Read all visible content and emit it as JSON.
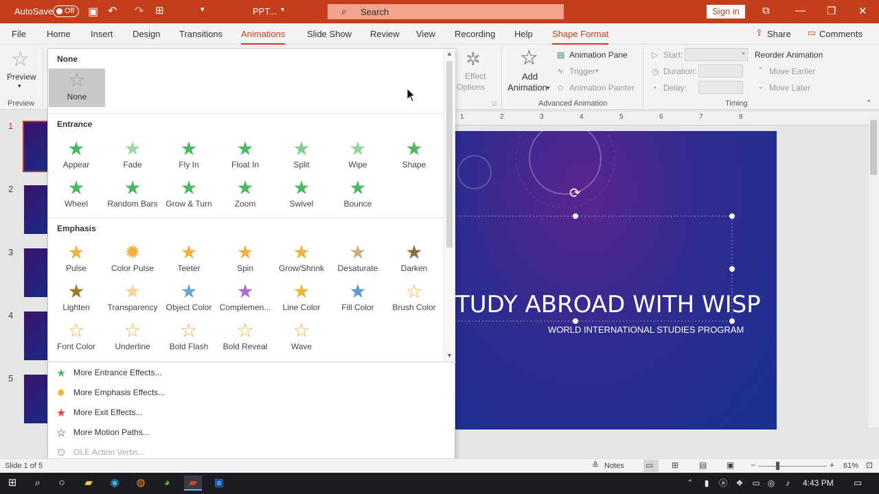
{
  "titlebar": {
    "autosave_label": "AutoSave",
    "autosave_state": "Off",
    "file_name": "PPT...",
    "search_placeholder": "Search",
    "signin_label": "Sign in"
  },
  "menu": {
    "tabs": [
      "File",
      "Home",
      "Insert",
      "Design",
      "Transitions",
      "Animations",
      "Slide Show",
      "Review",
      "View",
      "Recording",
      "Help",
      "Shape Format"
    ],
    "share_label": "Share",
    "comments_label": "Comments"
  },
  "ribbon": {
    "preview_label": "Preview",
    "preview_group": "Preview",
    "effect_options_1": "Effect",
    "effect_options_2": "Options",
    "add_animation_1": "Add",
    "add_animation_2": "Animation",
    "animation_pane": "Animation Pane",
    "trigger": "Trigger",
    "animation_painter": "Animation Painter",
    "advanced_group": "Advanced Animation",
    "start_label": "Start:",
    "duration_label": "Duration:",
    "delay_label": "Delay:",
    "reorder_label": "Reorder Animation",
    "move_earlier": "Move Earlier",
    "move_later": "Move Later",
    "timing_group": "Timing"
  },
  "gallery": {
    "none_header": "None",
    "none_item": "None",
    "entrance_header": "Entrance",
    "entrance": [
      "Appear",
      "Fade",
      "Fly In",
      "Float In",
      "Split",
      "Wipe",
      "Shape",
      "Wheel",
      "Random Bars",
      "Grow & Turn",
      "Zoom",
      "Swivel",
      "Bounce"
    ],
    "emphasis_header": "Emphasis",
    "emphasis": [
      "Pulse",
      "Color Pulse",
      "Teeter",
      "Spin",
      "Grow/Shrink",
      "Desaturate",
      "Darken",
      "Lighten",
      "Transparency",
      "Object Color",
      "Complemen...",
      "Line Color",
      "Fill Color",
      "Brush Color",
      "Font Color",
      "Underline",
      "Bold Flash",
      "Bold Reveal",
      "Wave"
    ],
    "more_entrance": "More Entrance Effects...",
    "more_emphasis": "More Emphasis Effects...",
    "more_exit": "More Exit Effects...",
    "more_motion": "More Motion Paths...",
    "ole_verbs": "OLE Action Verbs..."
  },
  "thumbnails": [
    "1",
    "2",
    "3",
    "4",
    "5"
  ],
  "slide": {
    "title": "TUDY ABROAD WITH WISP",
    "subtitle": "WORLD INTERNATIONAL STUDIES PROGRAM"
  },
  "ruler_numbers": [
    "1",
    "2",
    "3",
    "4",
    "5",
    "6",
    "7",
    "8"
  ],
  "status": {
    "slide_info": "Slide 1 of 5",
    "notes_label": "Notes",
    "zoom": "61%"
  },
  "taskbar": {
    "time": "4:43 PM"
  },
  "colors": {
    "accent": "#c43e1c",
    "entrance_green": "#4bb862",
    "emphasis_gold": "#f0b23c"
  }
}
